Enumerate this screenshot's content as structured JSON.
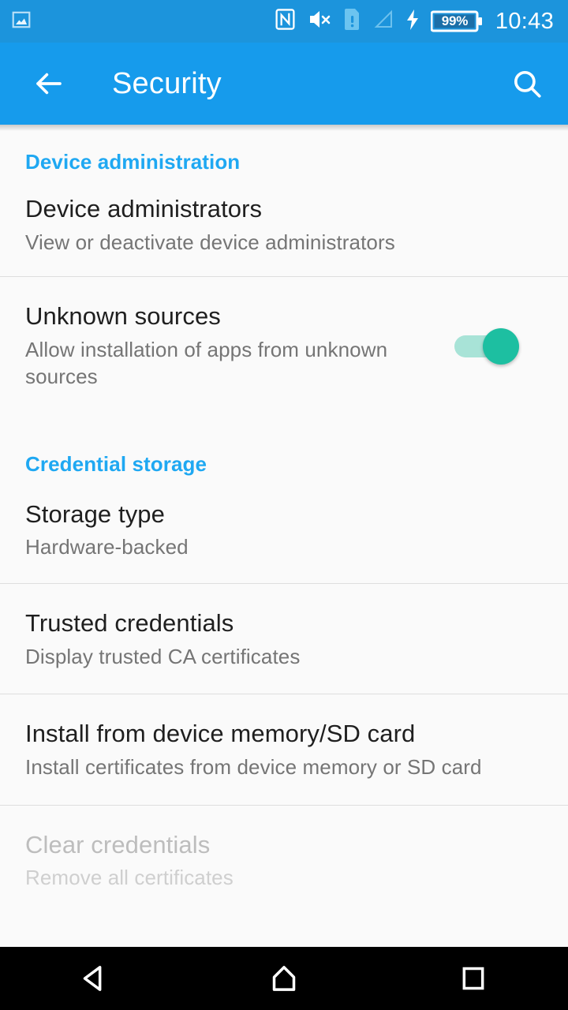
{
  "status_bar": {
    "clock": "10:43",
    "battery_percent": "99%",
    "icons": [
      "image-notification-icon",
      "nfc-icon",
      "volume-muted-icon",
      "sim-card-alert-icon",
      "signal-no-service-icon",
      "charging-bolt-icon",
      "battery-icon"
    ],
    "background_color": "#1c94dc"
  },
  "app_bar": {
    "title": "Security",
    "back_icon": "arrow-back-icon",
    "search_icon": "search-icon",
    "background_color": "#169bec"
  },
  "sections": [
    {
      "header": "Device administration",
      "rows": [
        {
          "title": "Device administrators",
          "summary": "View or deactivate device administrators",
          "type": "link",
          "enabled": true
        },
        {
          "title": "Unknown sources",
          "summary": "Allow installation of apps from unknown sources",
          "type": "switch",
          "enabled": true,
          "checked": true
        }
      ]
    },
    {
      "header": "Credential storage",
      "rows": [
        {
          "title": "Storage type",
          "summary": "Hardware-backed",
          "type": "link",
          "enabled": true
        },
        {
          "title": "Trusted credentials",
          "summary": "Display trusted CA certificates",
          "type": "link",
          "enabled": true
        },
        {
          "title": "Install from device memory/SD card",
          "summary": "Install certificates from device memory or SD card",
          "type": "link",
          "enabled": true
        },
        {
          "title": "Clear credentials",
          "summary": "Remove all certificates",
          "type": "link",
          "enabled": false
        }
      ]
    }
  ],
  "nav_bar": {
    "back": "nav-back-icon",
    "home": "nav-home-icon",
    "recents": "nav-recents-icon",
    "background_color": "#000000"
  },
  "colors": {
    "accent_blue": "#1fa8f2",
    "switch_on": "#1dbfa1",
    "switch_track": "#a8e3d7",
    "page_background": "#fafafa",
    "divider": "#dedede"
  }
}
